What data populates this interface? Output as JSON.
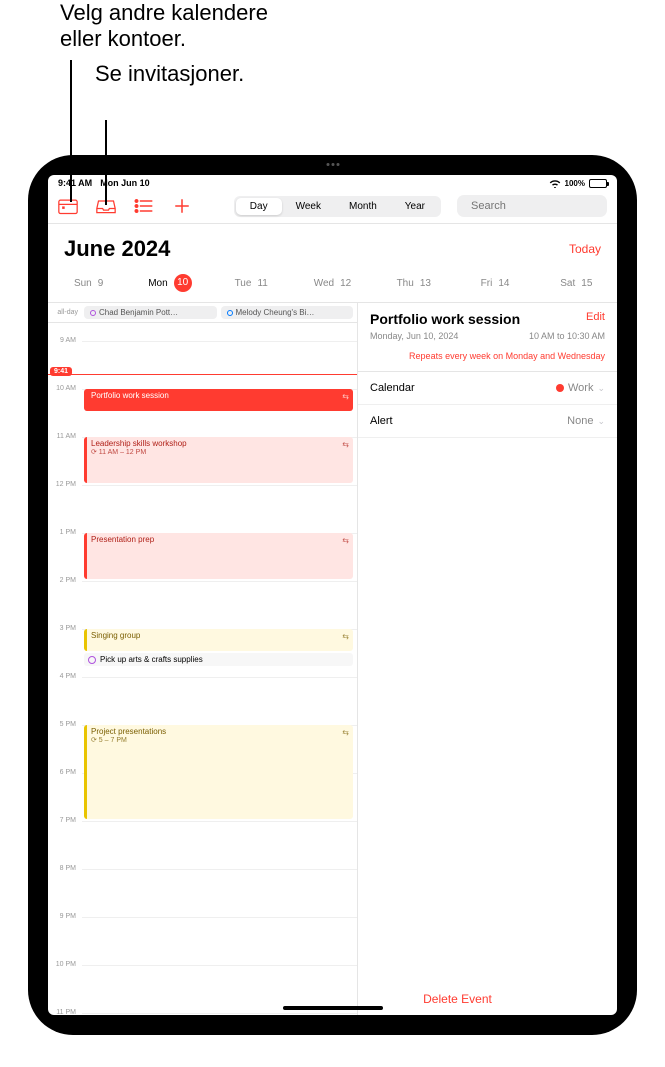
{
  "callouts": {
    "c1_line1": "Velg andre kalendere",
    "c1_line2": "eller kontoer.",
    "c2": "Se invitasjoner."
  },
  "status": {
    "time": "9:41 AM",
    "date": "Mon Jun 10",
    "wifi_icon": "wifi",
    "battery_pct": "100%"
  },
  "toolbar": {
    "views": {
      "day": "Day",
      "week": "Week",
      "month": "Month",
      "year": "Year",
      "active": "Day"
    },
    "search_placeholder": "Search"
  },
  "header": {
    "month": "June 2024",
    "today": "Today",
    "days": [
      {
        "name": "Sun",
        "num": "9",
        "current": false
      },
      {
        "name": "Mon",
        "num": "10",
        "current": true
      },
      {
        "name": "Tue",
        "num": "11",
        "current": false
      },
      {
        "name": "Wed",
        "num": "12",
        "current": false
      },
      {
        "name": "Thu",
        "num": "13",
        "current": false
      },
      {
        "name": "Fri",
        "num": "14",
        "current": false
      },
      {
        "name": "Sat",
        "num": "15",
        "current": false
      }
    ]
  },
  "allday": {
    "label": "all-day",
    "items": [
      {
        "title": "Chad Benjamin Pott…",
        "color": "purple"
      },
      {
        "title": "Melody Cheung's Bi…",
        "color": "blue"
      }
    ]
  },
  "timeline": {
    "now": "9:41",
    "hours": [
      "9 AM",
      "10 AM",
      "11 AM",
      "12 PM",
      "1 PM",
      "2 PM",
      "3 PM",
      "4 PM",
      "5 PM",
      "6 PM",
      "7 PM",
      "8 PM",
      "9 PM",
      "10 PM",
      "11 PM"
    ]
  },
  "events": [
    {
      "title": "Portfolio work session",
      "sub": "",
      "start": 10,
      "end": 10.5,
      "style": "red-solid"
    },
    {
      "title": "Leadership skills workshop",
      "sub": "⟳ 11 AM – 12 PM",
      "start": 11,
      "end": 12,
      "style": "red-light"
    },
    {
      "title": "Presentation prep",
      "sub": "",
      "start": 13,
      "end": 14,
      "style": "red-light"
    },
    {
      "title": "Singing group",
      "sub": "",
      "start": 15,
      "end": 15.5,
      "style": "yellow-light"
    },
    {
      "title": "Project presentations",
      "sub": "⟳ 5 – 7 PM",
      "start": 17,
      "end": 19,
      "style": "yellow-light"
    }
  ],
  "reminder": {
    "title": "Pick up arts & crafts supplies",
    "at": 15.5
  },
  "detail": {
    "title": "Portfolio work session",
    "edit": "Edit",
    "date": "Monday, Jun 10, 2024",
    "time": "10 AM to 10:30 AM",
    "repeat": "Repeats every week on Monday and Wednesday",
    "rows": {
      "calendar_label": "Calendar",
      "calendar_value": "Work",
      "alert_label": "Alert",
      "alert_value": "None"
    },
    "delete": "Delete Event"
  }
}
